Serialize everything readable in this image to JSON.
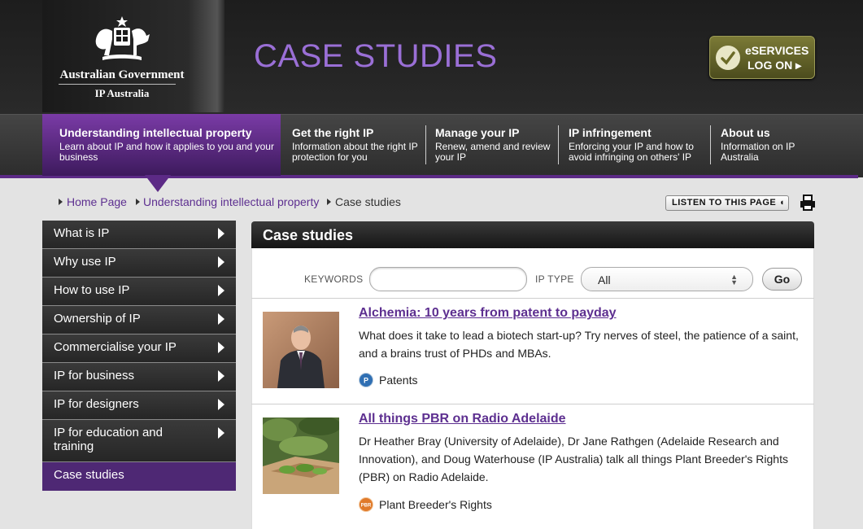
{
  "header": {
    "gov_title": "Australian Government",
    "gov_subtitle": "IP Australia",
    "page_heading": "CASE STUDIES",
    "eservices_line1": "eSERVICES",
    "eservices_line2": "LOG ON ▸"
  },
  "nav": [
    {
      "title": "Understanding intellectual property",
      "desc": "Learn about IP and how it applies to you and your business"
    },
    {
      "title": "Get the right IP",
      "desc": "Information about the right IP protection for you"
    },
    {
      "title": "Manage your IP",
      "desc": "Renew, amend and review your IP"
    },
    {
      "title": "IP infringement",
      "desc": "Enforcing your IP and how to avoid infringing on others' IP"
    },
    {
      "title": "About us",
      "desc": "Information on IP Australia"
    }
  ],
  "breadcrumb": {
    "home": "Home Page",
    "section": "Understanding intellectual property",
    "current": "Case studies"
  },
  "toolbar": {
    "listen_label": "LISTEN TO THIS PAGE ◖"
  },
  "sidebar": [
    {
      "label": "What is IP"
    },
    {
      "label": "Why use IP"
    },
    {
      "label": "How to use IP"
    },
    {
      "label": "Ownership of IP"
    },
    {
      "label": "Commercialise your IP"
    },
    {
      "label": "IP for business"
    },
    {
      "label": "IP for designers"
    },
    {
      "label": "IP for education and training"
    },
    {
      "label": "Case studies"
    }
  ],
  "main": {
    "heading": "Case studies",
    "filter": {
      "keywords_label": "KEYWORDS",
      "keywords_value": "",
      "ip_type_label": "IP TYPE",
      "ip_type_value": "All",
      "go_label": "Go"
    },
    "stories": [
      {
        "title": "Alchemia: 10 years from patent to payday",
        "desc": "What does it take to lead a biotech start-up? Try nerves of steel, the patience of a saint, and a brains trust of PHDs and MBAs.",
        "tag_badge": "P",
        "tag": "Patents",
        "badge_color": "#2f6fb3"
      },
      {
        "title": "All things PBR on Radio Adelaide",
        "desc": "Dr Heather Bray (University of Adelaide), Dr Jane Rathgen (Adelaide Research and Innovation), and Doug Waterhouse (IP Australia) talk all things Plant Breeder's Rights (PBR) on Radio Adelaide.",
        "tag_badge": "PBR",
        "tag": "Plant Breeder's Rights",
        "badge_color": "#e07a2a"
      }
    ]
  }
}
